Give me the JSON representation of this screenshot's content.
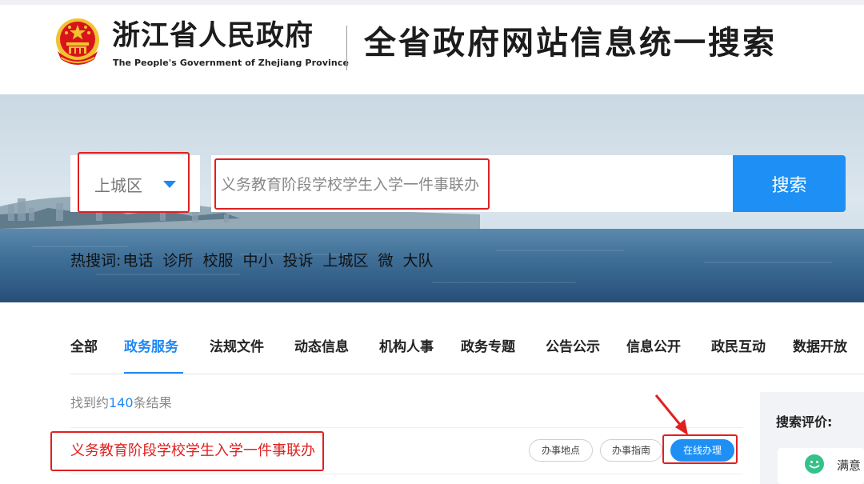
{
  "header": {
    "gov_name_cn": "浙江省人民政府",
    "gov_name_en": "The People's Government of Zhejiang Province",
    "site_title": "全省政府网站信息统一搜索"
  },
  "search": {
    "region": "上城区",
    "query": "义务教育阶段学校学生入学一件事联办",
    "button_label": "搜索"
  },
  "hot_words": {
    "label": "热搜词:",
    "items": [
      "电话",
      "诊所",
      "校服",
      "中小",
      "投诉",
      "上城区",
      "微",
      "大队"
    ]
  },
  "tabs": [
    {
      "label": "全部",
      "active": false
    },
    {
      "label": "政务服务",
      "active": true
    },
    {
      "label": "法规文件",
      "active": false
    },
    {
      "label": "动态信息",
      "active": false
    },
    {
      "label": "机构人事",
      "active": false
    },
    {
      "label": "政务专题",
      "active": false
    },
    {
      "label": "公告公示",
      "active": false
    },
    {
      "label": "信息公开",
      "active": false
    },
    {
      "label": "政民互动",
      "active": false
    },
    {
      "label": "数据开放",
      "active": false
    }
  ],
  "results": {
    "count_prefix": "找到约",
    "count": "140",
    "count_suffix": "条结果",
    "items": [
      {
        "title": "义务教育阶段学校学生入学一件事联办",
        "actions": [
          "办事地点",
          "办事指南",
          "在线办理"
        ]
      }
    ]
  },
  "evaluation": {
    "title": "搜索评价:",
    "option_label": "满意"
  },
  "colors": {
    "accent": "#1e90f5",
    "highlight": "#e02020",
    "emblem_red": "#d8141b",
    "emblem_gold": "#f2c230"
  }
}
